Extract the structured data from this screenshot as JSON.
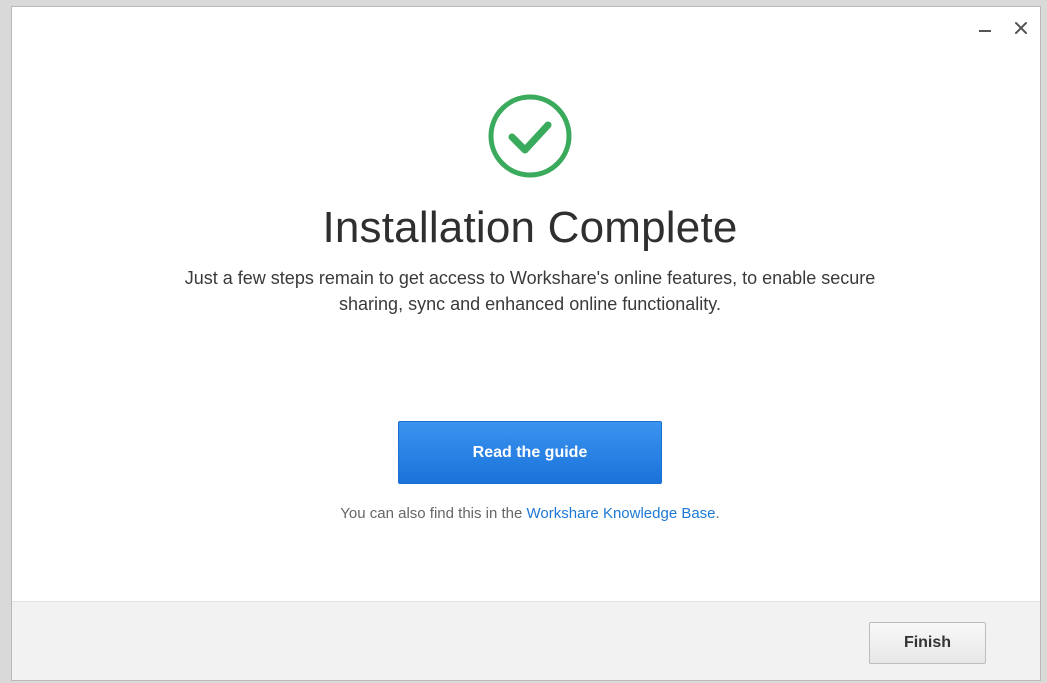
{
  "window": {
    "minimize_label": "–",
    "close_label": "×"
  },
  "status_icon": "checkmark-circle-icon",
  "main": {
    "title": "Installation Complete",
    "subtitle": "Just a few steps remain to get access to Workshare's online features, to enable secure sharing, sync and enhanced online functionality.",
    "guide_button_label": "Read the guide",
    "kb_prefix": "You can also find this in the ",
    "kb_link_text": "Workshare Knowledge Base",
    "kb_suffix": "."
  },
  "footer": {
    "finish_label": "Finish"
  },
  "colors": {
    "success_green": "#3aaa5c",
    "primary_blue": "#1f7be0",
    "link_blue": "#1c79d6",
    "footer_bg": "#f2f2f2"
  }
}
